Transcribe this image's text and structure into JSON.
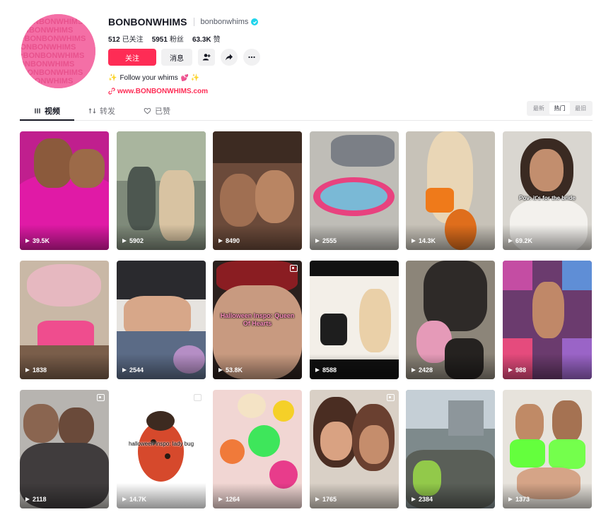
{
  "profile": {
    "username": "BONBONWHIMS",
    "handle": "bonbonwhims",
    "following_count": "512",
    "following_label": "已关注",
    "followers_count": "5951",
    "followers_label": "粉丝",
    "likes_count": "63.3K",
    "likes_label": "赞",
    "avatar_text": "♥BONBONWHIMS",
    "bio": "Follow your whims",
    "link": "www.BONBONWHIMS.com",
    "colors": {
      "accent": "#fe2c55",
      "avatar": "#f46fa6",
      "verified": "#20d5ec"
    }
  },
  "actions": {
    "follow_label": "关注",
    "message_label": "消息",
    "add_friend_icon": "person-add-icon",
    "share_icon": "share-arrow-icon",
    "more_icon": "more-dots-icon"
  },
  "tabs": [
    {
      "label": "视频",
      "icon": "grid-lines-icon",
      "active": true
    },
    {
      "label": "转发",
      "icon": "repost-icon",
      "active": false
    },
    {
      "label": "已赞",
      "icon": "heart-outline-icon",
      "active": false
    }
  ],
  "sort": [
    {
      "label": "最新",
      "active": false
    },
    {
      "label": "热门",
      "active": true
    },
    {
      "label": "最旧",
      "active": false
    }
  ],
  "videos": [
    {
      "views": "39.5K",
      "overlay": "",
      "pinned": false
    },
    {
      "views": "5902",
      "overlay": "",
      "pinned": false
    },
    {
      "views": "8490",
      "overlay": "",
      "pinned": false
    },
    {
      "views": "2555",
      "overlay": "",
      "pinned": false
    },
    {
      "views": "14.3K",
      "overlay": "",
      "pinned": false
    },
    {
      "views": "69.2K",
      "overlay": "Pov: it's for the bride",
      "pinned": false
    },
    {
      "views": "1838",
      "overlay": "",
      "pinned": false
    },
    {
      "views": "2544",
      "overlay": "",
      "pinned": false
    },
    {
      "views": "53.8K",
      "overlay": "Halloween Inspo: Queen Of Hearts",
      "pinned": true
    },
    {
      "views": "8588",
      "overlay": "",
      "pinned": false
    },
    {
      "views": "2428",
      "overlay": "",
      "pinned": false
    },
    {
      "views": "988",
      "overlay": "",
      "pinned": false
    },
    {
      "views": "2118",
      "overlay": "",
      "pinned": true
    },
    {
      "views": "14.7K",
      "overlay": "halloween inspo: lady bug",
      "pinned": true
    },
    {
      "views": "1264",
      "overlay": "",
      "pinned": false
    },
    {
      "views": "1765",
      "overlay": "",
      "pinned": true
    },
    {
      "views": "2384",
      "overlay": "",
      "pinned": false
    },
    {
      "views": "1373",
      "overlay": "",
      "pinned": false
    }
  ]
}
